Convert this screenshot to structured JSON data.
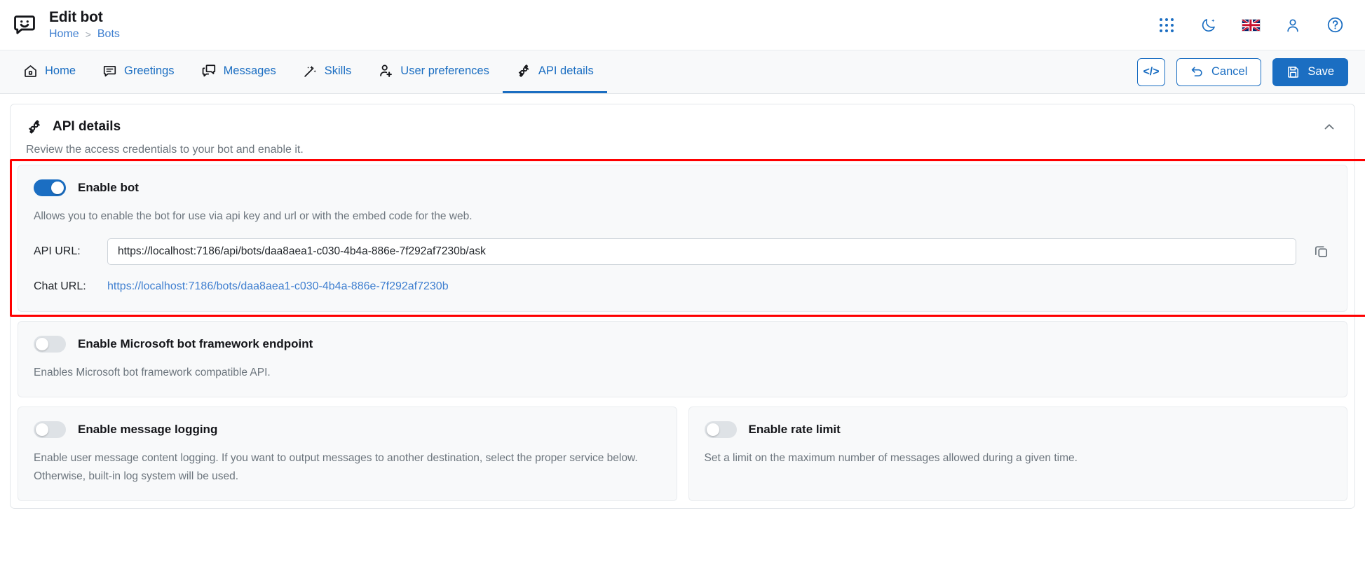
{
  "header": {
    "logo_icon": "chat-bubble-smiley-icon",
    "title": "Edit bot",
    "breadcrumb": [
      {
        "label": "Home"
      },
      {
        "label": ">"
      },
      {
        "label": "Bots"
      }
    ],
    "icons": [
      {
        "name": "apps-grid-icon",
        "label": "Apps"
      },
      {
        "name": "moon-dark-mode-icon",
        "label": "Dark mode"
      },
      {
        "name": "uk-flag-icon",
        "label": "Language"
      },
      {
        "name": "user-account-icon",
        "label": "Account"
      },
      {
        "name": "help-circle-icon",
        "label": "Help"
      }
    ]
  },
  "tabs": [
    {
      "label": "Home",
      "icon": "home-icon",
      "active": false
    },
    {
      "label": "Greetings",
      "icon": "chat-bubble-icon",
      "active": false
    },
    {
      "label": "Messages",
      "icon": "messages-icon",
      "active": false
    },
    {
      "label": "Skills",
      "icon": "magic-wand-icon",
      "active": false
    },
    {
      "label": "User preferences",
      "icon": "user-settings-icon",
      "active": false
    },
    {
      "label": "API details",
      "icon": "plug-connect-icon",
      "active": true
    }
  ],
  "toolbar": {
    "code_label": "</>",
    "cancel_label": "Cancel",
    "save_label": "Save"
  },
  "panel": {
    "icon": "plug-connect-icon",
    "title": "API details",
    "subtitle": "Review the access credentials to your bot and enable it.",
    "collapse_icon": "chevron-up-icon"
  },
  "enable_bot": {
    "toggle_on": true,
    "label": "Enable bot",
    "description": "Allows you to enable the bot for use via api key and url or with the embed code for the web.",
    "api_url_label": "API URL:",
    "api_url_value": "https://localhost:7186/api/bots/daa8aea1-c030-4b4a-886e-7f292af7230b/ask",
    "api_url_placeholder": "API URL",
    "copy_icon": "copy-icon",
    "chat_url_label": "Chat URL:",
    "chat_url_value": "https://localhost:7186/bots/daa8aea1-c030-4b4a-886e-7f292af7230b"
  },
  "ms_framework": {
    "toggle_on": false,
    "label": "Enable Microsoft bot framework endpoint",
    "description": "Enables Microsoft bot framework compatible API."
  },
  "message_logging": {
    "toggle_on": false,
    "label": "Enable message logging",
    "description": "Enable user message content logging. If you want to output messages to another destination, select the proper service below. Otherwise, built-in log system will be used."
  },
  "rate_limit": {
    "toggle_on": false,
    "label": "Enable rate limit",
    "description": "Set a limit on the maximum number of messages allowed during a given time."
  },
  "colors": {
    "accent": "#1b6ec2",
    "link": "#3f7fd0",
    "highlight": "#ff0000",
    "card_bg": "#f8f9fa",
    "muted": "#6c757d"
  }
}
